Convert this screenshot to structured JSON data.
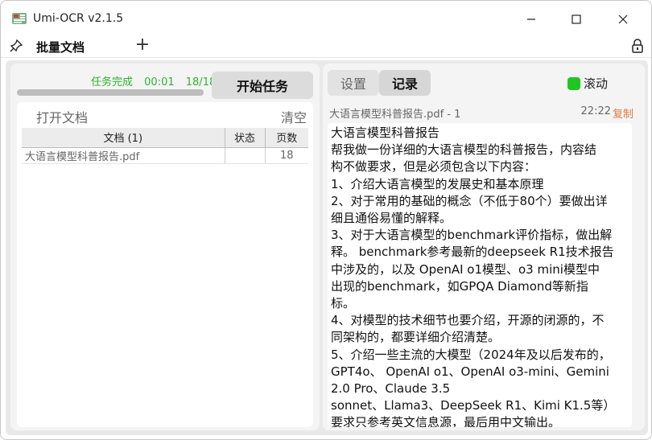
{
  "window": {
    "title": "Umi-OCR v2.1.5",
    "minimize": "—",
    "maximize": "☐",
    "close": "✕"
  },
  "tabs": {
    "active_label": "批量文档",
    "add_label": "+"
  },
  "left": {
    "status_label": "任务完成",
    "elapsed": "00:01",
    "progress_text": "18/18",
    "progress_fraction": 1.0,
    "start_button": "开始任务",
    "open_docs": "打开文档",
    "clear": "清空",
    "table": {
      "headers": [
        "文档 (1)",
        "状态",
        "页数"
      ],
      "rows": [
        {
          "name": "大语言模型科普报告.pdf",
          "status": "",
          "pages": "18"
        }
      ]
    }
  },
  "right": {
    "tab_settings": "设置",
    "tab_log": "记录",
    "scroll_label": "滚动",
    "scroll_on_color": "#21c521",
    "record": {
      "file_label": "大语言模型科普报告.pdf - 1",
      "time": "22:22",
      "copy_label": "复制",
      "lines": [
        "大语言模型科普报告",
        "帮我做一份详细的大语言模型的科普报告，内容结",
        "构不做要求，但是必须包含以下内容：",
        "1、介绍大语言模型的发展史和基本原理",
        "2、对于常用的基础的概念（不低于80个）要做出详",
        "细且通俗易懂的解释。",
        "3、对于大语言模型的benchmark评价指标，做出解",
        "释。 benchmark参考最新的deepseek R1技术报告",
        "中涉及的，以及 OpenAI o1模型、o3 mini模型中",
        "出现的benchmark，如GPQA  Diamond等新指",
        "标。",
        "4、对模型的技术细节也要介绍，开源的闭源的，不",
        "同架构的，都要详细介绍清楚。",
        "5、介绍一些主流的大模型（2024年及以后发布的，",
        "GPT4o、 OpenAI o1、OpenAI o3-mini、Gemini",
        "2.0 Pro、Claude 3.5",
        "sonnet、Llama3、DeepSeek R1、Kimi K1.5等）",
        "要求只参考英文信息源，最后用中文输出。"
      ]
    }
  }
}
